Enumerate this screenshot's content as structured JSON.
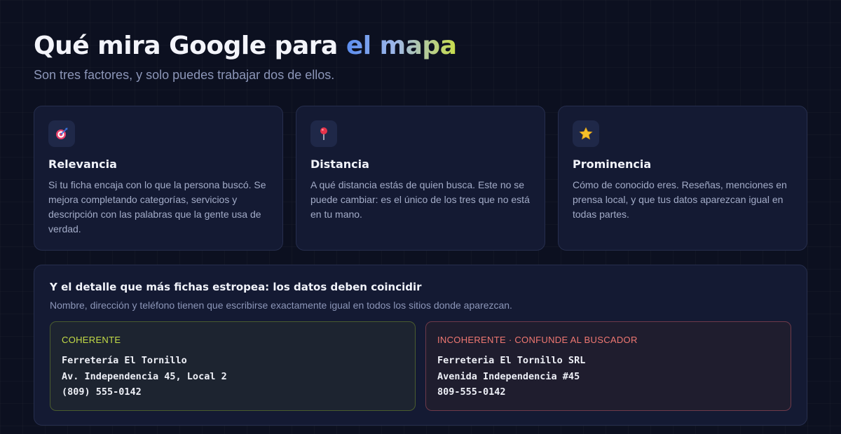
{
  "header": {
    "title_main": "Qué mira Google para ",
    "title_accent": "el mapa",
    "subtitle": "Son tres factores, y solo puedes trabajar dos de ellos."
  },
  "cards": [
    {
      "icon": "target-icon",
      "title": "Relevancia",
      "text": "Si tu ficha encaja con lo que la persona buscó. Se mejora completando categorías, servicios y descripción con las palabras que la gente usa de verdad."
    },
    {
      "icon": "pin-icon",
      "title": "Distancia",
      "text": "A qué distancia estás de quien busca. Este no se puede cambiar: es el único de los tres que no está en tu mano."
    },
    {
      "icon": "star-icon",
      "title": "Prominencia",
      "text": "Cómo de conocido eres. Reseñas, menciones en prensa local, y que tus datos aparezcan igual en todas partes."
    }
  ],
  "panel": {
    "title": "Y el detalle que más fichas estropea: los datos deben coincidir",
    "description": "Nombre, dirección y teléfono tienen que escribirse exactamente igual en todos los sitios donde aparezcan.",
    "good": {
      "label": "COHERENTE",
      "lines": [
        "Ferretería El Tornillo",
        "Av. Independencia 45, Local 2",
        "(809) 555-0142"
      ]
    },
    "bad": {
      "label": "INCOHERENTE · CONFUNDE AL BUSCADOR",
      "lines": [
        "Ferreteria El Tornillo SRL",
        "Avenida Independencia #45",
        "809-555-0142"
      ]
    }
  },
  "colors": {
    "background": "#0c1020",
    "card": "#141a33",
    "good_accent": "#c5dd47",
    "bad_accent": "#f07872"
  }
}
